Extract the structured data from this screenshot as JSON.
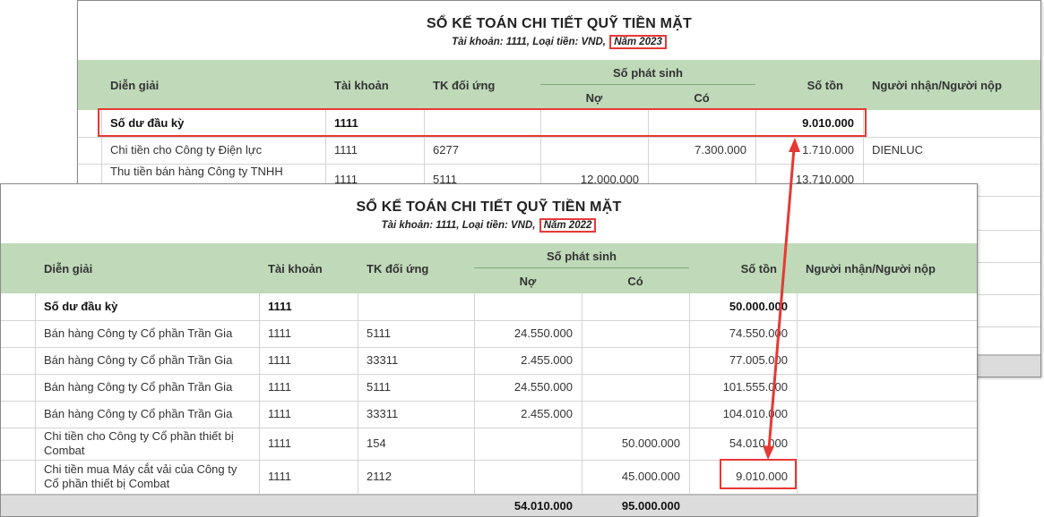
{
  "back_report": {
    "title": "SỔ KẾ TOÁN CHI TIẾT QUỸ TIỀN MẶT",
    "subtitle_prefix": "Tài khoản: 1111, Loại tiền: VND,",
    "year": "Năm 2023",
    "headers": {
      "dien_giai": "Diễn giải",
      "tai_khoan": "Tài khoản",
      "tk_doi_ung": "TK đối ứng",
      "so_phat_sinh": "Số phát sinh",
      "no": "Nợ",
      "co": "Có",
      "so_ton": "Số tồn",
      "nguoi": "Người nhận/Người nộp"
    },
    "opening": {
      "dien_giai": "Số dư đầu kỳ",
      "tai_khoan": "1111",
      "so_ton": "9.010.000"
    },
    "rows": [
      {
        "dien_giai": "Chi tiền cho Công ty Điện lực",
        "tai_khoan": "1111",
        "tk_doi_ung": "6277",
        "no": "",
        "co": "7.300.000",
        "so_ton": "1.710.000",
        "nguoi": "DIENLUC"
      },
      {
        "dien_giai": "Thu tiền bán hàng Công ty TNHH",
        "tai_khoan": "1111",
        "tk_doi_ung": "5111",
        "no": "12.000.000",
        "co": "",
        "so_ton": "13.710.000",
        "nguoi": ""
      }
    ]
  },
  "front_report": {
    "title": "SỔ KẾ TOÁN CHI TIẾT QUỸ TIỀN MẶT",
    "subtitle_prefix": "Tài khoản: 1111, Loại tiền: VND,",
    "year": "Năm 2022",
    "headers": {
      "dien_giai": "Diễn giải",
      "tai_khoan": "Tài khoản",
      "tk_doi_ung": "TK đối ứng",
      "so_phat_sinh": "Số phát sinh",
      "no": "Nợ",
      "co": "Có",
      "so_ton": "Số tồn",
      "nguoi": "Người nhận/Người nộp"
    },
    "opening": {
      "dien_giai": "Số dư đầu kỳ",
      "tai_khoan": "1111",
      "so_ton": "50.000.000"
    },
    "rows": [
      {
        "dien_giai": "Bán hàng Công ty Cổ phần Trần Gia",
        "tai_khoan": "1111",
        "tk_doi_ung": "5111",
        "no": "24.550.000",
        "co": "",
        "so_ton": "74.550.000",
        "nguoi": ""
      },
      {
        "dien_giai": "Bán hàng Công ty Cổ phần Trần Gia",
        "tai_khoan": "1111",
        "tk_doi_ung": "33311",
        "no": "2.455.000",
        "co": "",
        "so_ton": "77.005.000",
        "nguoi": ""
      },
      {
        "dien_giai": "Bán hàng Công ty Cổ phần Trần Gia",
        "tai_khoan": "1111",
        "tk_doi_ung": "5111",
        "no": "24.550.000",
        "co": "",
        "so_ton": "101.555.000",
        "nguoi": ""
      },
      {
        "dien_giai": "Bán hàng Công ty Cổ phần Trần Gia",
        "tai_khoan": "1111",
        "tk_doi_ung": "33311",
        "no": "2.455.000",
        "co": "",
        "so_ton": "104.010.000",
        "nguoi": ""
      },
      {
        "dien_giai": "Chi tiền cho Công ty Cổ phần thiết bị Combat",
        "tai_khoan": "1111",
        "tk_doi_ung": "154",
        "no": "",
        "co": "50.000.000",
        "so_ton": "54.010.000",
        "nguoi": ""
      },
      {
        "dien_giai": "Chi tiền mua Máy cắt vải của Công ty Cổ phần thiết bị Combat",
        "tai_khoan": "1111",
        "tk_doi_ung": "2112",
        "no": "",
        "co": "45.000.000",
        "so_ton": "9.010.000",
        "nguoi": ""
      }
    ],
    "totals": {
      "no": "54.010.000",
      "co": "95.000.000"
    }
  },
  "colors": {
    "header_bg": "#bfd9b9",
    "highlight": "#e53935",
    "footer_bg": "#dcdcdc"
  }
}
